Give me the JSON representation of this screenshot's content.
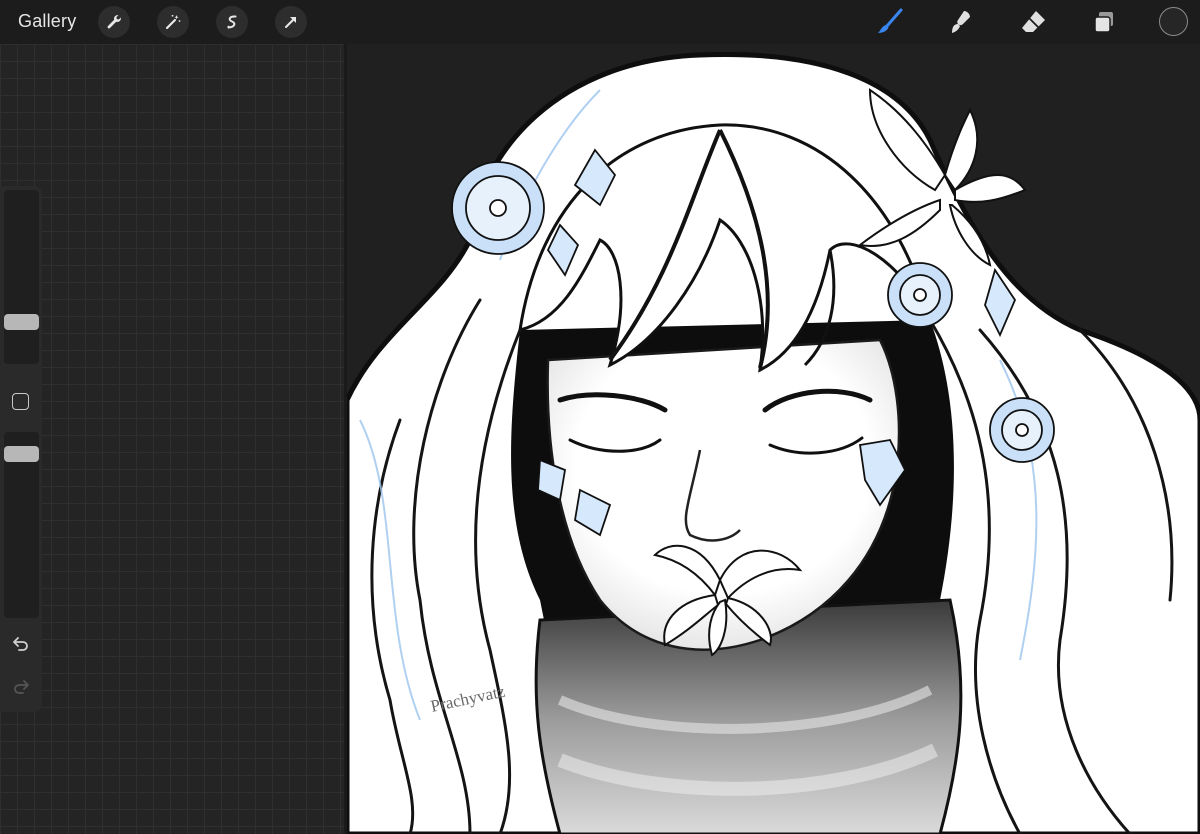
{
  "topbar": {
    "gallery_label": "Gallery",
    "left_tools": [
      "wrench-icon",
      "magic-wand-icon",
      "selection-icon",
      "move-arrow-icon"
    ],
    "right_tools": [
      "brush-icon",
      "smudge-icon",
      "eraser-icon",
      "layers-icon",
      "color-swatch"
    ],
    "active_tool_color": "#3a86f0"
  },
  "sidebar": {
    "controls": [
      "brush-size-slider",
      "modify-button",
      "opacity-slider",
      "undo-icon",
      "redo-icon"
    ]
  },
  "canvas": {
    "watermark": "Prachyvatz",
    "colors": {
      "line": "#111111",
      "blue_tint": "#9cc4ef",
      "paper": "#ffffff"
    }
  }
}
